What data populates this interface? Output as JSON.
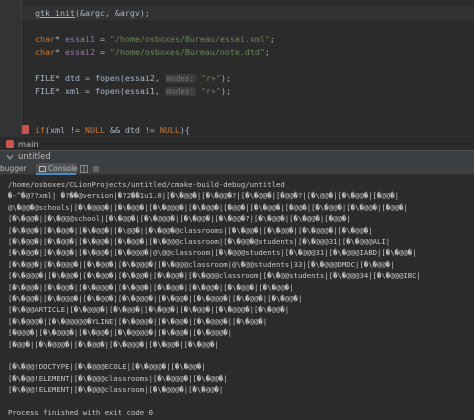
{
  "editor": {
    "lines": [
      {
        "segments": [
          [
            "fn",
            "gtk_init"
          ],
          [
            "punc",
            "(&argc, &argv);"
          ]
        ]
      },
      {
        "segments": []
      },
      {
        "segments": [
          [
            "kw",
            "char"
          ],
          [
            "punc",
            "* "
          ],
          [
            "var",
            "essai1"
          ],
          [
            "punc",
            " = "
          ],
          [
            "str",
            "\"/home/osboxes/Bureau/essai.xml\""
          ],
          [
            "punc",
            ";"
          ]
        ]
      },
      {
        "segments": [
          [
            "kw",
            "char"
          ],
          [
            "punc",
            "* "
          ],
          [
            "var",
            "essai2"
          ],
          [
            "punc",
            " = "
          ],
          [
            "str",
            "\"/home/osboxes/Bureau/note.dtd\""
          ],
          [
            "punc",
            ";"
          ]
        ]
      },
      {
        "segments": []
      },
      {
        "segments": [
          [
            "fn",
            "FILE"
          ],
          [
            "punc",
            "* dtd = fopen(essai2, "
          ],
          [
            "inlay",
            "modes:"
          ],
          [
            "str",
            " \"r+\""
          ],
          [
            "punc",
            ");"
          ]
        ]
      },
      {
        "segments": [
          [
            "fn",
            "FILE"
          ],
          [
            "punc",
            "* xml = fopen(essai1, "
          ],
          [
            "inlay",
            "modes:"
          ],
          [
            "str",
            " \"r+\""
          ],
          [
            "punc",
            ");"
          ]
        ]
      },
      {
        "segments": []
      },
      {
        "segments": []
      },
      {
        "segments": [
          [
            "kw",
            "if"
          ],
          [
            "punc",
            "(xml != "
          ],
          [
            "kw",
            "NULL"
          ],
          [
            "punc",
            " && dtd != "
          ],
          [
            "kw",
            "NULL"
          ],
          [
            "punc",
            "){"
          ]
        ]
      }
    ],
    "breadcrumb": "main"
  },
  "run_window": {
    "title": "untitled",
    "tabs": [
      {
        "label": "bugger"
      },
      {
        "label": "Console"
      }
    ]
  },
  "console": {
    "lines": [
      "/home/osboxes/CLionProjects/untitled/cmake-build-debug/untitled",
      "�-^�@??xml| �?��@version|�?2��1u1.0|[�\\�@@�|[�\\�@@�?|[�\\�@@�|[�@@�?|[�\\@@�|[�\\�@@�|[�@@�|",
      "@\\�@@�@schools|[�\\�@@@�|[�\\�@@�|[�\\�@@@�|[�\\�@@�|[�@@�|[�\\�@@�|[�@@�|[�\\�@@�|[�\\�@@�|[�@@�|",
      "[�\\�@@�|[�\\�@@@school|[�\\�@@�|[�\\�@@@�|[�\\�@@�|[�\\�@@�?|[�\\�@@�|[�\\�@@�|[�@@�|",
      "[�\\�@@�|[�\\�@@�|[�\\�@@�|[�\\@@�|[�\\�@@�@classrooms|[�\\�@@�|[�\\�@@�|[�\\�@@@�|[�\\�@@�|",
      "[�\\�@@�|[�\\�@@�|[�\\�@@�|[�\\�@@�|[�\\�@@@classroom|[�\\�@@�@students|[�\\�@@@31|[�\\�@@@ALI|",
      "[�\\�@@�|[�\\�@@�|[�\\�@@�|[�\\�@@@�|@\\@@classroom|[�\\�@@@students|[�\\�@@@31|[�\\�@@@IABD|[�\\�@@�|",
      "[�\\�@@�|[�\\�@@@�|[�\\�@@�|[�\\�@@@�|[�\\�@@@classroom|@\\�@@students|33|[�\\�@@@DMDC|[�\\�@@�|",
      "[�\\�@@@�|[�\\�@@�|[�\\�@@�|[�\\�@@�|[�\\�@@�|[�\\�@@@classroom|[�\\�@@students|[�\\�@@@34|[�\\�@@@IBC|",
      "[�\\�@@�|[�\\�@@�|[�\\�@@@�|[�\\�@@�|[�\\�@@�|[�\\�@@�|[�\\�@@�|[�\\�@@�|",
      "[�\\�@@�|[�\\�@@@�|[�\\�@@�|[�\\�@@@�|[�\\�@@�|[�\\�@@@�|[�\\�@@�|[�\\�@@�|",
      "[�\\�@@ARTICLE|[�\\�@@@�|[�\\�@@�|[�\\�@@�|[�\\�@@�|[�\\�@@@�|[�\\�@@�|",
      "[�\\�@@@�|[�\\�@@@@@�YLINE|[�\\�@@@�|[�\\�@@�|[�\\�@@@�|[�\\�@@�|",
      "[�@@@�|[�\\�@@@�|[�\\�@@�|[�\\�@@@@�|[�\\�@@�|[�\\�@@@�|",
      "[�@@�|[�\\�@@@�|[�\\�@@�|[�\\�@@@�|[�\\�@@�|[�\\�@@�|",
      "",
      "[�\\�@@!DOCTYPE|[�\\�@@@ECOLE|[�\\�@@@�|[�\\�@@�|",
      "[�\\�@@!ELEMENT|[�\\�@@@classrooms|[�\\�@@@�|[�\\�@@�|",
      "[�\\�@@!ELEMENT|[�\\�@@@classroom|[�\\�@@@�|[�\\�@@�|",
      "",
      "Process finished with exit code 0"
    ]
  }
}
